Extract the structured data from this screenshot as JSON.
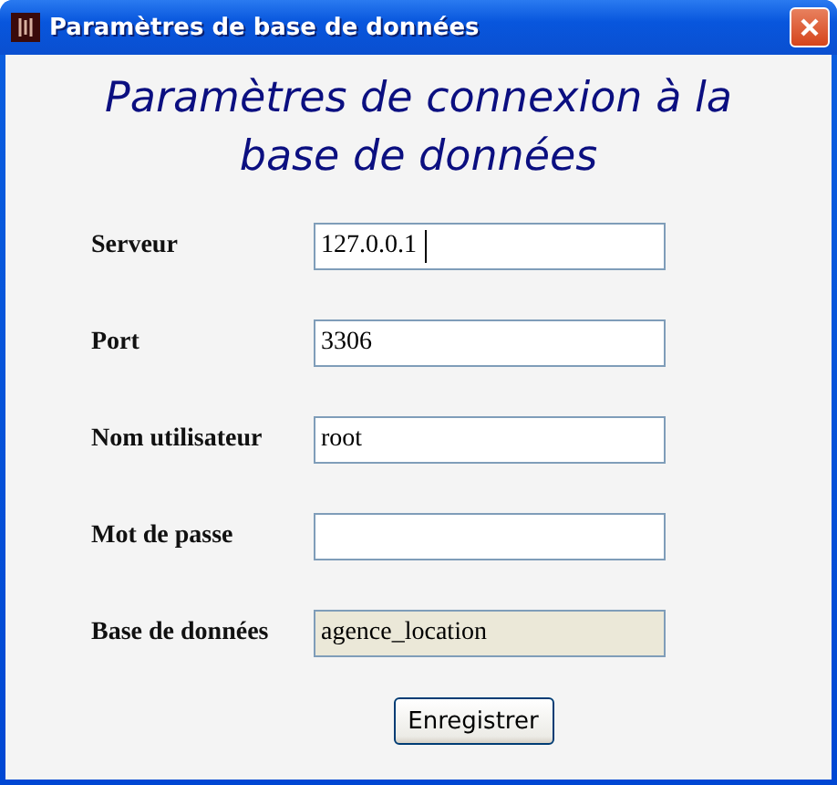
{
  "window": {
    "title": "Paramètres de base de données"
  },
  "heading": "Paramètres de connexion à la base de données",
  "fields": [
    {
      "label": "Serveur",
      "value": "127.0.0.1",
      "disabled": false,
      "focused": true
    },
    {
      "label": "Port",
      "value": "3306",
      "disabled": false,
      "focused": false
    },
    {
      "label": "Nom utilisateur",
      "value": "root",
      "disabled": false,
      "focused": false
    },
    {
      "label": "Mot de passe",
      "disabled": false,
      "focused": false
    },
    {
      "label": "Base de données",
      "value": "agence_location",
      "disabled": true,
      "focused": false
    }
  ],
  "buttons": [
    "Enregistrer"
  ]
}
